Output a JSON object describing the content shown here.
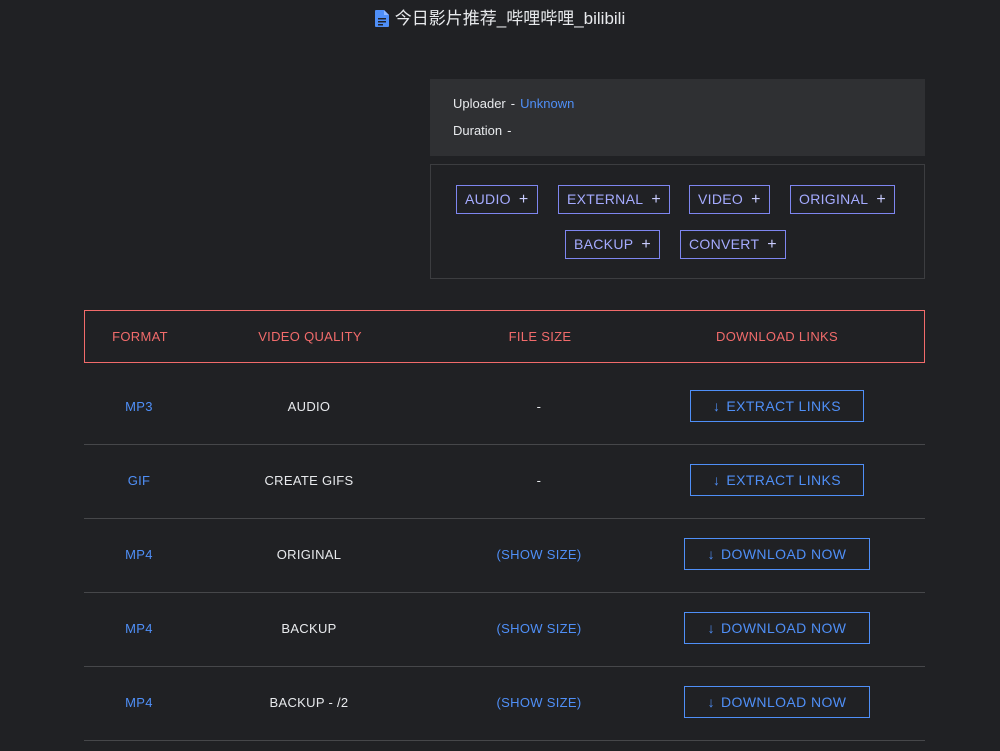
{
  "header": {
    "title": "今日影片推荐_哔哩哔哩_bilibili"
  },
  "info": {
    "uploader_label": "Uploader",
    "uploader_sep": "-",
    "uploader_value": "Unknown",
    "duration_label": "Duration",
    "duration_sep": "-"
  },
  "tags": [
    "AUDIO",
    "EXTERNAL",
    "VIDEO",
    "ORIGINAL",
    "BACKUP",
    "CONVERT"
  ],
  "table": {
    "headers": [
      "FORMAT",
      "VIDEO QUALITY",
      "FILE SIZE",
      "DOWNLOAD LINKS"
    ],
    "rows": [
      {
        "format": "MP3",
        "quality": "AUDIO",
        "size": "-",
        "action": "EXTRACT LINKS"
      },
      {
        "format": "GIF",
        "quality": "CREATE GIFS",
        "size": "-",
        "action": "EXTRACT LINKS"
      },
      {
        "format": "MP4",
        "quality": "ORIGINAL",
        "size": "(SHOW SIZE)",
        "action": "DOWNLOAD NOW"
      },
      {
        "format": "MP4",
        "quality": "BACKUP",
        "size": "(SHOW SIZE)",
        "action": "DOWNLOAD NOW"
      },
      {
        "format": "MP4",
        "quality": "BACKUP - /2",
        "size": "(SHOW SIZE)",
        "action": "DOWNLOAD NOW"
      }
    ]
  },
  "colors": {
    "accent": "#4f8ff7",
    "tag": "#7e86f0",
    "header_red": "#f26b6b",
    "background": "#202124"
  }
}
